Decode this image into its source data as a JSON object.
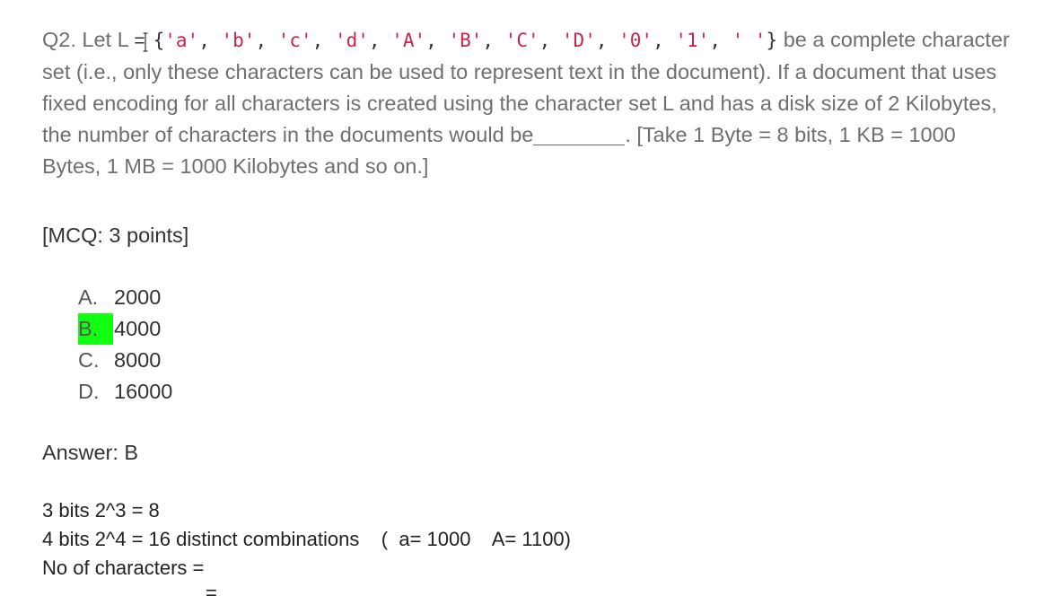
{
  "question": {
    "prefix": "Q2. Let L ",
    "equals": "=",
    "set_open": "{",
    "set_items": [
      "'a'",
      "'b'",
      "'c'",
      "'d'",
      "'A'",
      "'B'",
      "'C'",
      "'D'",
      "'0'",
      "'1'",
      "' '"
    ],
    "separator": ", ",
    "set_close": "}",
    "text_after_set": " be a complete character set (i.e., only these characters can be used to represent text in the document). If a document that uses fixed encoding for all characters is created using the character set L and has a disk size of 2 Kilobytes, the number of characters in the documents would be",
    "text_after_blank": ". [Take 1 Byte = 8 bits, 1 KB = 1000 Bytes, 1 MB = 1000 Kilobytes and so on.]"
  },
  "points_label": "[MCQ: 3 points]",
  "options": [
    {
      "letter": "A.",
      "value": "2000",
      "highlighted": false
    },
    {
      "letter": "B.",
      "value": "4000",
      "highlighted": true
    },
    {
      "letter": "C.",
      "value": "8000",
      "highlighted": false
    },
    {
      "letter": "D.",
      "value": "16000",
      "highlighted": false
    }
  ],
  "answer": "Answer: B",
  "work_lines": [
    "3 bits 2^3 = 8",
    "4 bits 2^4 = 16 distinct combinations    (  a= 1000    A= 1100)",
    "No of characters ="
  ],
  "stray_equals": "=",
  "colors": {
    "highlight": "#12ff12",
    "code_string": "#c7254e",
    "question_text": "#6f6f6f"
  }
}
